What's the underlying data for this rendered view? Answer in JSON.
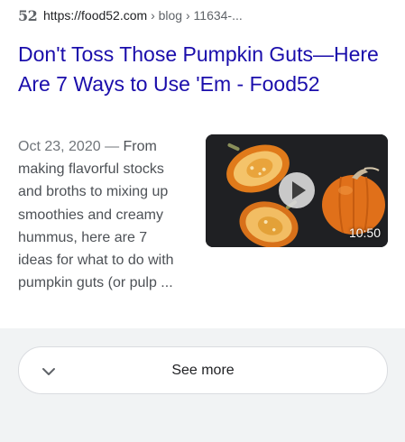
{
  "result": {
    "favicon_text": "52",
    "url_domain": "https://food52.com",
    "url_path": " › blog › 11634-...",
    "title": "Don't Toss Those Pumpkin Guts—Here Are 7 Ways to Use 'Em - Food52",
    "snippet_date": "Oct 23, 2020",
    "snippet_separator": " — ",
    "snippet_text": "From making flavorful stocks and broths to mixing up smoothies and creamy hummus, here are 7 ideas for what to do with pumpkin guts (or pulp ...",
    "video": {
      "duration": "10:50",
      "icon": "play-icon"
    }
  },
  "see_more": {
    "label": "See more",
    "icon": "chevron-down-icon"
  },
  "colors": {
    "link": "#1a0dab",
    "snippet": "#4d5156",
    "page_background": "#f1f3f4"
  }
}
